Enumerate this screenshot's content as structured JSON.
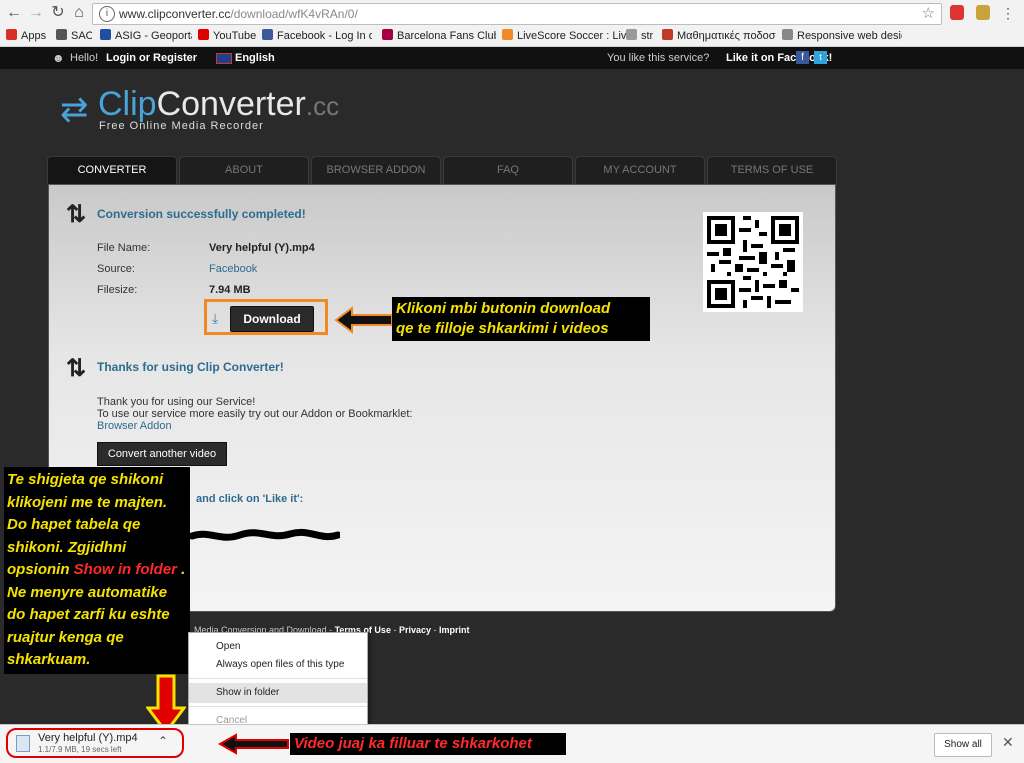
{
  "browser": {
    "url_host": "www.clipconverter.cc",
    "url_path": "/download/wfK4vRAn/0/",
    "bookmarks": [
      {
        "label": "Apps",
        "color": "#d93025"
      },
      {
        "label": "SAO",
        "color": "#555555"
      },
      {
        "label": "ASIG - Geoportal",
        "color": "#1f4fa0"
      },
      {
        "label": "YouTube",
        "color": "#e00000"
      },
      {
        "label": "Facebook - Log In or",
        "color": "#3b5998"
      },
      {
        "label": "Barcelona Fans Club -",
        "color": "#a50044"
      },
      {
        "label": "LiveScore Soccer : Liv",
        "color": "#f08a24"
      },
      {
        "label": "str",
        "color": "#999999"
      },
      {
        "label": "Μαθηματικές ποδοσ",
        "color": "#c0392b"
      },
      {
        "label": "Responsive web desig",
        "color": "#888888"
      }
    ]
  },
  "sitebar": {
    "hello": "Hello!",
    "login": "Login or Register",
    "language": "English",
    "like_text": "You like this service?",
    "like_link": "Like it on Facebook!"
  },
  "logo": {
    "clip": "Clip",
    "converter": "Converter",
    "cc": ".cc",
    "subtitle": "Free Online Media Recorder"
  },
  "tabs": [
    "CONVERTER",
    "ABOUT",
    "BROWSER ADDON",
    "FAQ",
    "MY ACCOUNT",
    "TERMS OF USE"
  ],
  "conversion": {
    "status": "Conversion successfully completed!",
    "file_name_label": "File Name:",
    "file_name": "Very helpful (Y).mp4",
    "source_label": "Source:",
    "source": "Facebook",
    "filesize_label": "Filesize:",
    "filesize": "7.94 MB",
    "download_label": "Download"
  },
  "callout_download": {
    "line1": "Klikoni mbi butonin download",
    "line2": "qe te filloje shkarkimi i videos"
  },
  "thanks": {
    "heading": "Thanks for using Clip Converter!",
    "line1": "Thank you for using our Service!",
    "line2": "To use our service more easily try out our Addon or Bookmarklet:",
    "addon_link": "Browser Addon",
    "convert_another": "Convert another video"
  },
  "like_partial": "and click on 'Like it':",
  "callout_left": {
    "part1": "Te shigjeta qe shikoni klikojeni me te majten. Do hapet tabela qe shikoni. Zgjidhni opsionin ",
    "highlight": "Show in folder",
    "part2": " . Ne menyre automatike do hapet zarfi ku eshte ruajtur kenga qe shkarkuam."
  },
  "footer": {
    "text": "Media Conversion and Download -",
    "terms": "Terms of Use",
    "privacy": "Privacy",
    "imprint": "Imprint",
    "sep": "-"
  },
  "context_menu": [
    "Open",
    "Always open files of this type",
    "Show in folder",
    "Cancel"
  ],
  "download_shelf": {
    "file_name": "Very helpful (Y).mp4",
    "progress_text": "1.1/7.9 MB, 19 secs left",
    "show_all": "Show all"
  },
  "callout_bottom": "Video juaj ka filluar te shkarkohet",
  "colors": {
    "accent_blue": "#2d6c8f",
    "highlight_orange": "#f08a24",
    "callout_yellow": "#f4e300",
    "callout_red": "#ff2a2a",
    "arrow_red": "#e00000"
  }
}
